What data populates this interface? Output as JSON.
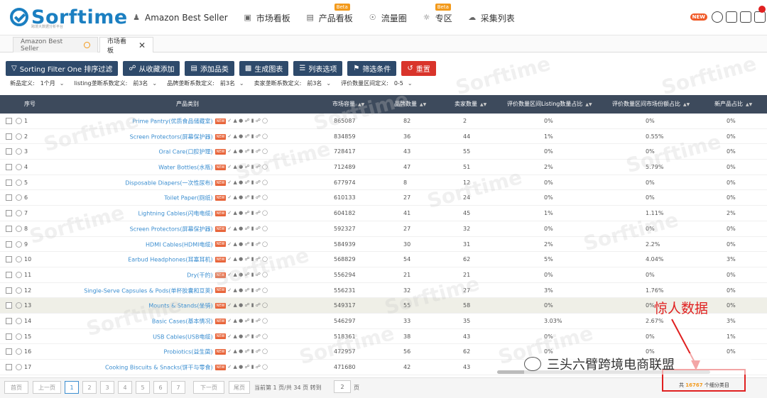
{
  "brand": {
    "name": "Sorftime",
    "sub": "跨境大数据分析平台"
  },
  "nav": [
    {
      "label": "Amazon Best Seller",
      "icon": "person-icon",
      "badge": ""
    },
    {
      "label": "市场看板",
      "icon": "board-icon",
      "badge": ""
    },
    {
      "label": "产品看板",
      "icon": "product-icon",
      "badge": "Beta"
    },
    {
      "label": "流量圈",
      "icon": "circle-icon",
      "badge": ""
    },
    {
      "label": "专区",
      "icon": "bulb-icon",
      "badge": "Beta"
    },
    {
      "label": "采集列表",
      "icon": "cloud-icon",
      "badge": ""
    }
  ],
  "header_right": {
    "new_label": "NEW"
  },
  "tabs": [
    {
      "label": "Amazon Best Seller"
    },
    {
      "label": "市场看板"
    }
  ],
  "toolbar": {
    "filter_btn": "Sorting Filter One 排序过滤",
    "fav_btn": "从收藏添加",
    "add_btn": "添加品类",
    "chart_btn": "生成图表",
    "cols_btn": "列表选项",
    "cond_btn": "筛选条件",
    "reset_btn": "重置"
  },
  "filters": [
    {
      "label": "新品定义:",
      "value": "1个月"
    },
    {
      "label": "listing垄断系数定义:",
      "value": "前3名"
    },
    {
      "label": "品牌垄断系数定义:",
      "value": "前3名"
    },
    {
      "label": "卖家垄断系数定义:",
      "value": "前3名"
    },
    {
      "label": "评价数量区间定义:",
      "value": "0-5"
    }
  ],
  "columns": [
    "序号",
    "产品类别",
    "市场容量",
    "品牌数量",
    "卖家数量",
    "评价数量区间Listing数量占比",
    "评价数量区间市场份额占比",
    "新产品占比"
  ],
  "rows": [
    {
      "idx": "1",
      "cat": "Prime Pantry(优质食品储藏室)",
      "cap": "865087",
      "brand": "82",
      "seller": "2",
      "rev_list": "0%",
      "rev_share": "0%",
      "new": "0%"
    },
    {
      "idx": "2",
      "cat": "Screen Protectors(屏幕保护器)",
      "cap": "834859",
      "brand": "36",
      "seller": "44",
      "rev_list": "1%",
      "rev_share": "0.55%",
      "new": "0%"
    },
    {
      "idx": "3",
      "cat": "Oral Care(口腔护理)",
      "cap": "728417",
      "brand": "43",
      "seller": "55",
      "rev_list": "0%",
      "rev_share": "0%",
      "new": "0%"
    },
    {
      "idx": "4",
      "cat": "Water Bottles(水瓶)",
      "cap": "712489",
      "brand": "47",
      "seller": "51",
      "rev_list": "2%",
      "rev_share": "5.79%",
      "new": "0%"
    },
    {
      "idx": "5",
      "cat": "Disposable Diapers(一次性尿布)",
      "cap": "677974",
      "brand": "8",
      "seller": "12",
      "rev_list": "0%",
      "rev_share": "0%",
      "new": "0%"
    },
    {
      "idx": "6",
      "cat": "Toilet Paper(厕纸)",
      "cap": "610133",
      "brand": "27",
      "seller": "24",
      "rev_list": "0%",
      "rev_share": "0%",
      "new": "0%"
    },
    {
      "idx": "7",
      "cat": "Lightning Cables(闪电电缆)",
      "cap": "604182",
      "brand": "41",
      "seller": "45",
      "rev_list": "1%",
      "rev_share": "1.11%",
      "new": "2%"
    },
    {
      "idx": "8",
      "cat": "Screen Protectors(屏幕保护器)",
      "cap": "592327",
      "brand": "27",
      "seller": "32",
      "rev_list": "0%",
      "rev_share": "0%",
      "new": "0%"
    },
    {
      "idx": "9",
      "cat": "HDMI Cables(HDMI电缆)",
      "cap": "584939",
      "brand": "30",
      "seller": "31",
      "rev_list": "2%",
      "rev_share": "2.2%",
      "new": "0%"
    },
    {
      "idx": "10",
      "cat": "Earbud Headphones(耳塞耳机)",
      "cap": "568829",
      "brand": "54",
      "seller": "62",
      "rev_list": "5%",
      "rev_share": "4.04%",
      "new": "3%"
    },
    {
      "idx": "11",
      "cat": "Dry(干的)",
      "cap": "556294",
      "brand": "21",
      "seller": "21",
      "rev_list": "0%",
      "rev_share": "0%",
      "new": "0%"
    },
    {
      "idx": "12",
      "cat": "Single-Serve Capsules & Pods(单杯胶囊和豆荚)",
      "cap": "556231",
      "brand": "32",
      "seller": "27",
      "rev_list": "3%",
      "rev_share": "1.76%",
      "new": "0%"
    },
    {
      "idx": "13",
      "cat": "Mounts & Stands(坐骑)",
      "cap": "549317",
      "brand": "55",
      "seller": "58",
      "rev_list": "0%",
      "rev_share": "0%",
      "new": "0%"
    },
    {
      "idx": "14",
      "cat": "Basic Cases(基本情况)",
      "cap": "546297",
      "brand": "33",
      "seller": "35",
      "rev_list": "3.03%",
      "rev_share": "2.67%",
      "new": "3%"
    },
    {
      "idx": "15",
      "cat": "USB Cables(USB电缆)",
      "cap": "518361",
      "brand": "38",
      "seller": "43",
      "rev_list": "0%",
      "rev_share": "0%",
      "new": "1%"
    },
    {
      "idx": "16",
      "cat": "Probiotics(益生菌)",
      "cap": "472957",
      "brand": "56",
      "seller": "62",
      "rev_list": "0%",
      "rev_share": "0%",
      "new": "0%"
    },
    {
      "idx": "17",
      "cat": "Cooking Biscuits & Snacks(饼干与零食)",
      "cap": "471680",
      "brand": "42",
      "seller": "43",
      "rev_list": "",
      "rev_share": "",
      "new": ""
    }
  ],
  "row_new_tag": "NEW",
  "pager": {
    "first": "首页",
    "prev": "上一页",
    "pages": [
      "1",
      "2",
      "3",
      "4",
      "5",
      "6",
      "7"
    ],
    "next": "下一页",
    "last": "尾页",
    "info": "当前第 1 页/共 34 页 转到",
    "goto": "2",
    "goto_suffix": "页"
  },
  "total": {
    "prefix": "共",
    "count": "16767",
    "suffix": "个细分类目"
  },
  "annotation": "惊人数据",
  "credit": "三头六臂跨境电商联盟",
  "watermark": "Sorftime"
}
